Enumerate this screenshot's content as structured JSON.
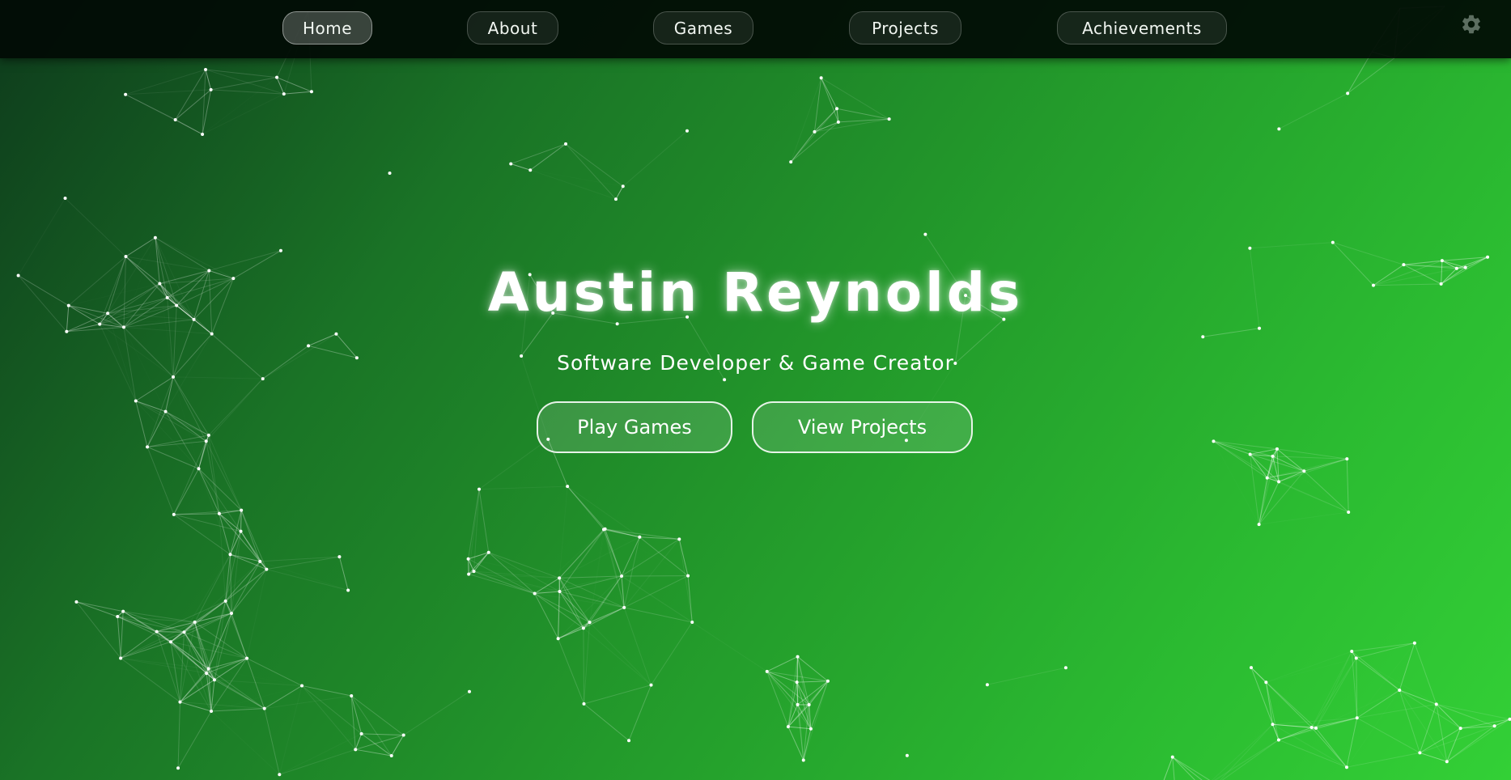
{
  "nav": {
    "items": [
      {
        "label": "Home",
        "active": true
      },
      {
        "label": "About",
        "active": false
      },
      {
        "label": "Games",
        "active": false
      },
      {
        "label": "Projects",
        "active": false
      },
      {
        "label": "Achievements",
        "active": false
      }
    ],
    "settings_icon": "gear-icon"
  },
  "hero": {
    "title": "Austin Reynolds",
    "subtitle": "Software Developer & Game Creator",
    "buttons": {
      "play_games": "Play Games",
      "view_projects": "View Projects"
    }
  },
  "colors": {
    "gradient_start": "#0e3b1c",
    "gradient_end": "#33d036",
    "navbar_bg": "#020a04",
    "text": "#ffffff"
  }
}
